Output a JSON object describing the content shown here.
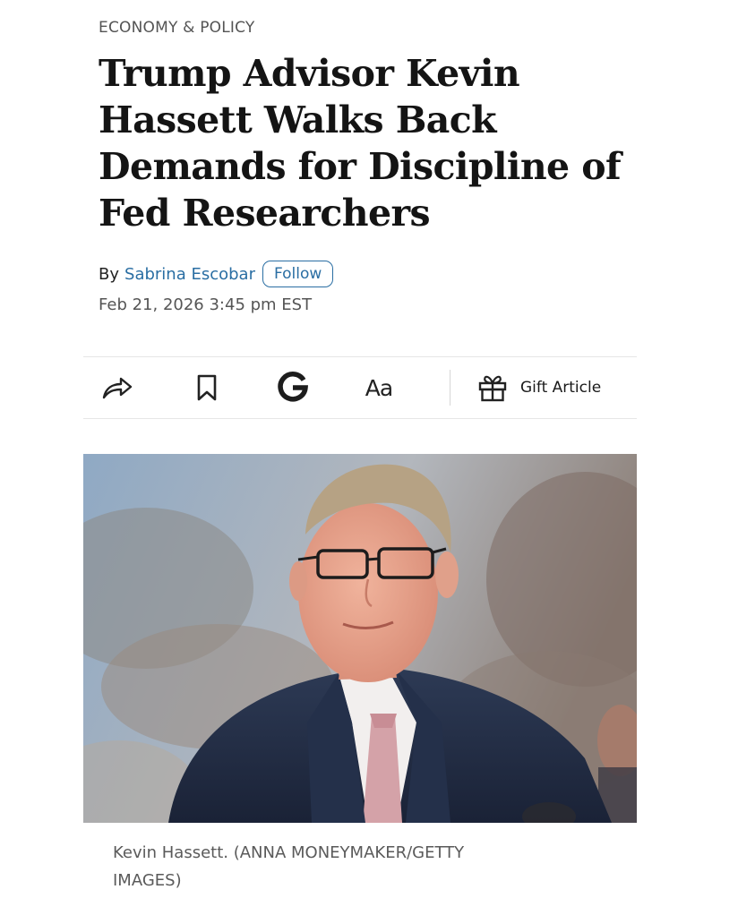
{
  "article": {
    "section": "ECONOMY & POLICY",
    "headline_lines": [
      "Trump Advisor Kevin",
      "Hassett Walks Back",
      "Demands for Discipline of",
      "Fed Researchers"
    ],
    "byline": {
      "prefix": "By",
      "author": "Sabrina Escobar",
      "follow_label": "Follow"
    },
    "timestamp": "Feb 21, 2026 3:45 pm EST"
  },
  "toolbar": {
    "share_icon": "share-arrow-icon",
    "bookmark_icon": "bookmark-icon",
    "google_icon": "google-g-icon",
    "text_size_label": "Aa",
    "gift_icon": "gift-icon",
    "gift_label": "Gift Article"
  },
  "photo": {
    "caption_lines": [
      "Kevin Hassett. (ANNA MONEYMAKER/GETTY",
      "IMAGES)"
    ]
  },
  "colors": {
    "accent_link": "#2a6ea3",
    "headline": "#141414",
    "meta_text": "#555555"
  }
}
